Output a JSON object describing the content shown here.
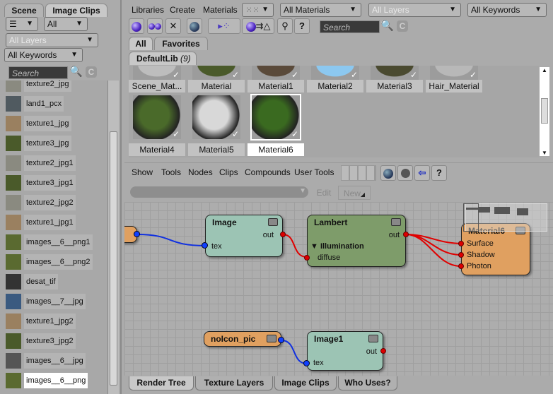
{
  "left": {
    "tabs": [
      "Scene",
      "Image Clips"
    ],
    "view_icon": "list-icon",
    "filter": "All",
    "layers": "All Layers",
    "keywords": "All Keywords",
    "search_placeholder": "Search",
    "items": [
      {
        "label": "texture2_jpg",
        "c": "#8a8a80"
      },
      {
        "label": "land1_pcx",
        "c": "#505a60"
      },
      {
        "label": "texture1_jpg",
        "c": "#9a8060"
      },
      {
        "label": "texture3_jpg",
        "c": "#4a5a2a"
      },
      {
        "label": "texture2_jpg1",
        "c": "#8a8a80"
      },
      {
        "label": "texture3_jpg1",
        "c": "#4a5a2a"
      },
      {
        "label": "texture2_jpg2",
        "c": "#8a8a80"
      },
      {
        "label": "texture1_jpg1",
        "c": "#9a8060"
      },
      {
        "label": "images__6__png1",
        "c": "#5a6a30"
      },
      {
        "label": "images__6__png2",
        "c": "#5a6a30"
      },
      {
        "label": "desat_tif",
        "c": "#333"
      },
      {
        "label": "images__7__jpg",
        "c": "#3a5a80"
      },
      {
        "label": "texture1_jpg2",
        "c": "#9a8060"
      },
      {
        "label": "texture3_jpg2",
        "c": "#4a5a2a"
      },
      {
        "label": "images__6__jpg",
        "c": "#555"
      },
      {
        "label": "images__6__png",
        "c": "#5a6a30"
      }
    ]
  },
  "top": {
    "menus": [
      "Libraries",
      "Create",
      "Materials"
    ],
    "materials_filter": "All Materials",
    "layers": "All Layers",
    "keywords": "All Keywords",
    "search_placeholder": "Search",
    "help": "?",
    "lib_tabs": [
      "All",
      "Favorites"
    ],
    "lib_name": "DefaultLib",
    "lib_count": "(9)",
    "materials": [
      {
        "label": "Scene_Mat...",
        "c": "#bdbdbd"
      },
      {
        "label": "Material",
        "c": "#4a5a2a"
      },
      {
        "label": "Material1",
        "c": "#5a4a3a"
      },
      {
        "label": "Material2",
        "c": "#8cc8f0"
      },
      {
        "label": "Material3",
        "c": "#4a4a30"
      },
      {
        "label": "Hair_Material",
        "c": "#b8b8b8"
      },
      {
        "label": "Material4",
        "c": "#4a6a2a"
      },
      {
        "label": "Material5",
        "c": "#d8d8d8"
      },
      {
        "label": "Material6",
        "c": "#3a6a20"
      }
    ]
  },
  "tree": {
    "menus": [
      "Show",
      "Tools",
      "Nodes",
      "Clips",
      "Compounds",
      "User Tools"
    ],
    "edit": "Edit",
    "new": "New",
    "nodes": {
      "image": {
        "title": "Image",
        "out": "out",
        "in": "tex"
      },
      "lambert": {
        "title": "Lambert",
        "out": "out",
        "group": "▼ Illumination",
        "in": "diffuse"
      },
      "material": {
        "title": "Material6",
        "ports": [
          "Surface",
          "Shadow",
          "Photon"
        ]
      },
      "noicon": {
        "title": "noIcon_pic"
      },
      "image1": {
        "title": "Image1",
        "out": "out",
        "in": "tex"
      }
    },
    "colors": {
      "image": "#9cc4b4",
      "lambert": "#7e9c6a",
      "material": "#e0a060",
      "wire_red": "#e00000",
      "wire_blue": "#1030e0"
    }
  },
  "bottom_tabs": [
    "Render Tree",
    "Texture Layers",
    "Image Clips",
    "Who Uses?"
  ]
}
